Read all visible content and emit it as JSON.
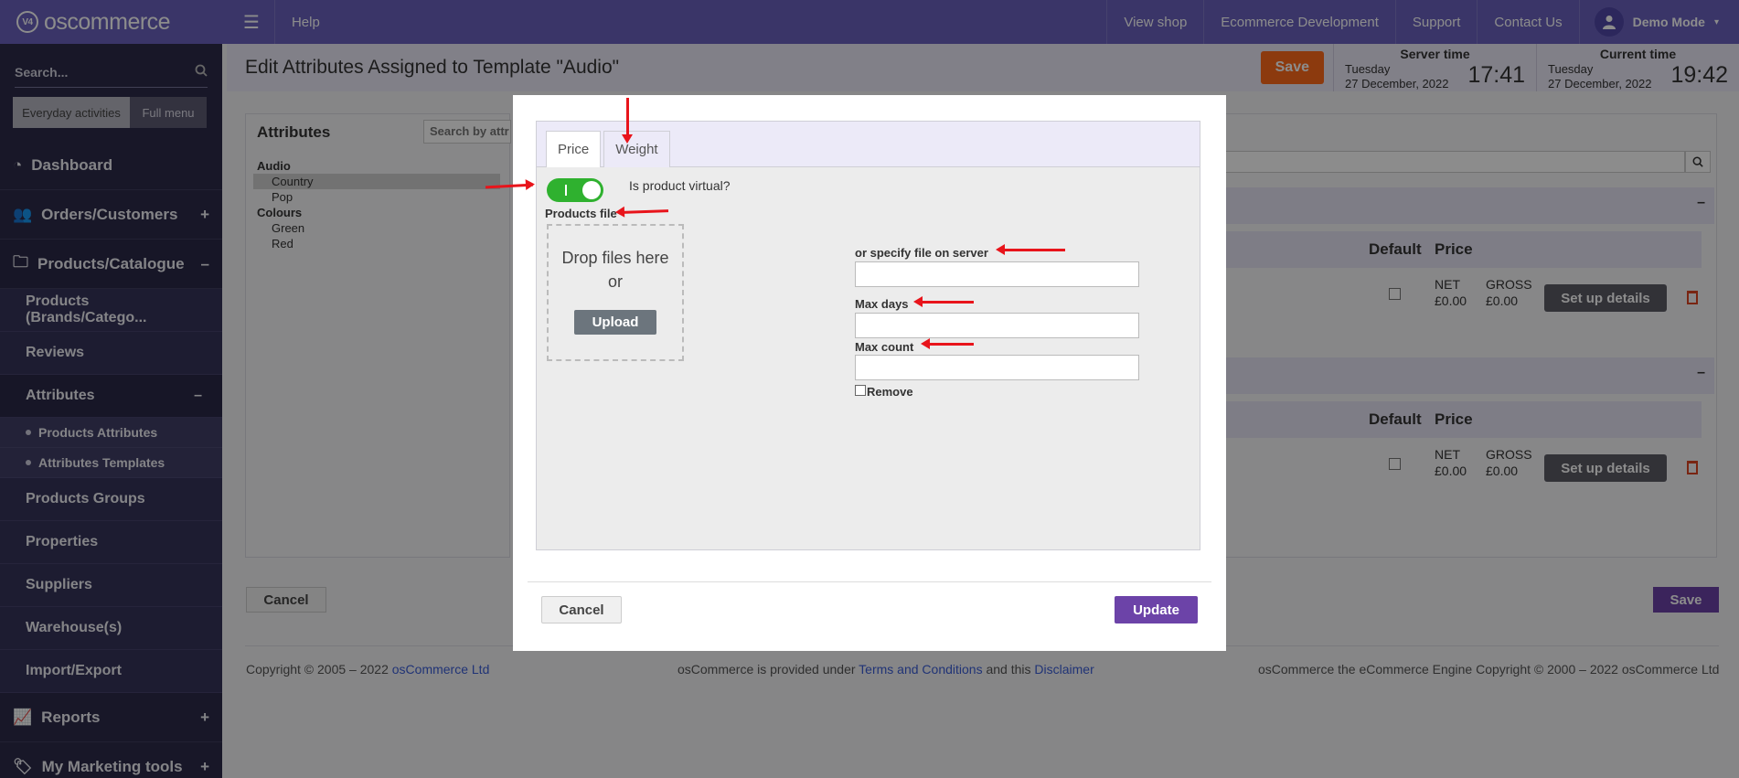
{
  "topbar": {
    "logo_text": "oscommerce",
    "logo_mark": "V4",
    "help": "Help",
    "links": [
      "View shop",
      "Ecommerce Development",
      "Support",
      "Contact Us"
    ],
    "user": "Demo Mode"
  },
  "sidebar": {
    "search_placeholder": "Search...",
    "pills": [
      "Everyday activities",
      "Full menu"
    ],
    "items": [
      {
        "label": "Dashboard",
        "icon": "dashboard-icon",
        "sign": ""
      },
      {
        "label": "Orders/Customers",
        "icon": "users-icon",
        "sign": "+"
      },
      {
        "label": "Products/Catalogue",
        "icon": "folder-icon",
        "sign": "–"
      },
      {
        "label": "Reports",
        "icon": "chart-icon",
        "sign": "+"
      },
      {
        "label": "My Marketing tools",
        "icon": "tag-icon",
        "sign": "+"
      }
    ],
    "sub_items": [
      "Products (Brands/Catego...",
      "Reviews",
      "Attributes",
      "Products Groups",
      "Properties",
      "Suppliers",
      "Warehouse(s)",
      "Import/Export"
    ],
    "attr_sign": "–",
    "attr_sub": [
      "Products Attributes",
      "Attributes Templates"
    ]
  },
  "header": {
    "title": "Edit Attributes Assigned to Template \"Audio\"",
    "save": "Save",
    "server_time_label": "Server time",
    "server_day": "Tuesday",
    "server_date": "27 December, 2022",
    "server_time": "17:41",
    "current_time_label": "Current time",
    "current_day": "Tuesday",
    "current_date": "27 December, 2022",
    "current_time": "19:42"
  },
  "background": {
    "attributes_title": "Attributes",
    "search_placeholder": "Search by attr",
    "tree": [
      {
        "label": "Audio",
        "bold": true
      },
      {
        "label": "Country",
        "bold": false
      },
      {
        "label": "Pop",
        "bold": false
      },
      {
        "label": "Colours",
        "bold": true
      },
      {
        "label": "Green",
        "bold": false
      },
      {
        "label": "Red",
        "bold": false
      }
    ],
    "col_default": "Default",
    "col_price": "Price",
    "net": "NET",
    "gross": "GROSS",
    "net_val": "£0.00",
    "gross_val": "£0.00",
    "setup": "Set up details",
    "cancel": "Cancel",
    "save": "Save",
    "collapse": "–"
  },
  "modal": {
    "tabs": [
      "Price",
      "Weight"
    ],
    "virtual_label": "Is product virtual?",
    "products_file": "Products file",
    "drop_line1": "Drop files here",
    "drop_line2": "or",
    "upload": "Upload",
    "specify_file": "or specify file on server",
    "max_days": "Max days",
    "max_count": "Max count",
    "remove": "Remove",
    "cancel": "Cancel",
    "update": "Update"
  },
  "footer": {
    "copyright": "Copyright © 2005 – 2022",
    "company": "osCommerce Ltd",
    "provided_pre": "osCommerce is provided under",
    "terms": "Terms and Conditions",
    "and_this": "and this",
    "disclaimer": "Disclaimer",
    "engine": "osCommerce the eCommerce Engine Copyright © 2000 – 2022 osCommerce Ltd"
  },
  "colors": {
    "accent": "#6a62bd",
    "save": "#ff6a1a",
    "update": "#6c43a8",
    "toggle_on": "#2fb12f",
    "annotation_arrow": "#e8141b"
  }
}
